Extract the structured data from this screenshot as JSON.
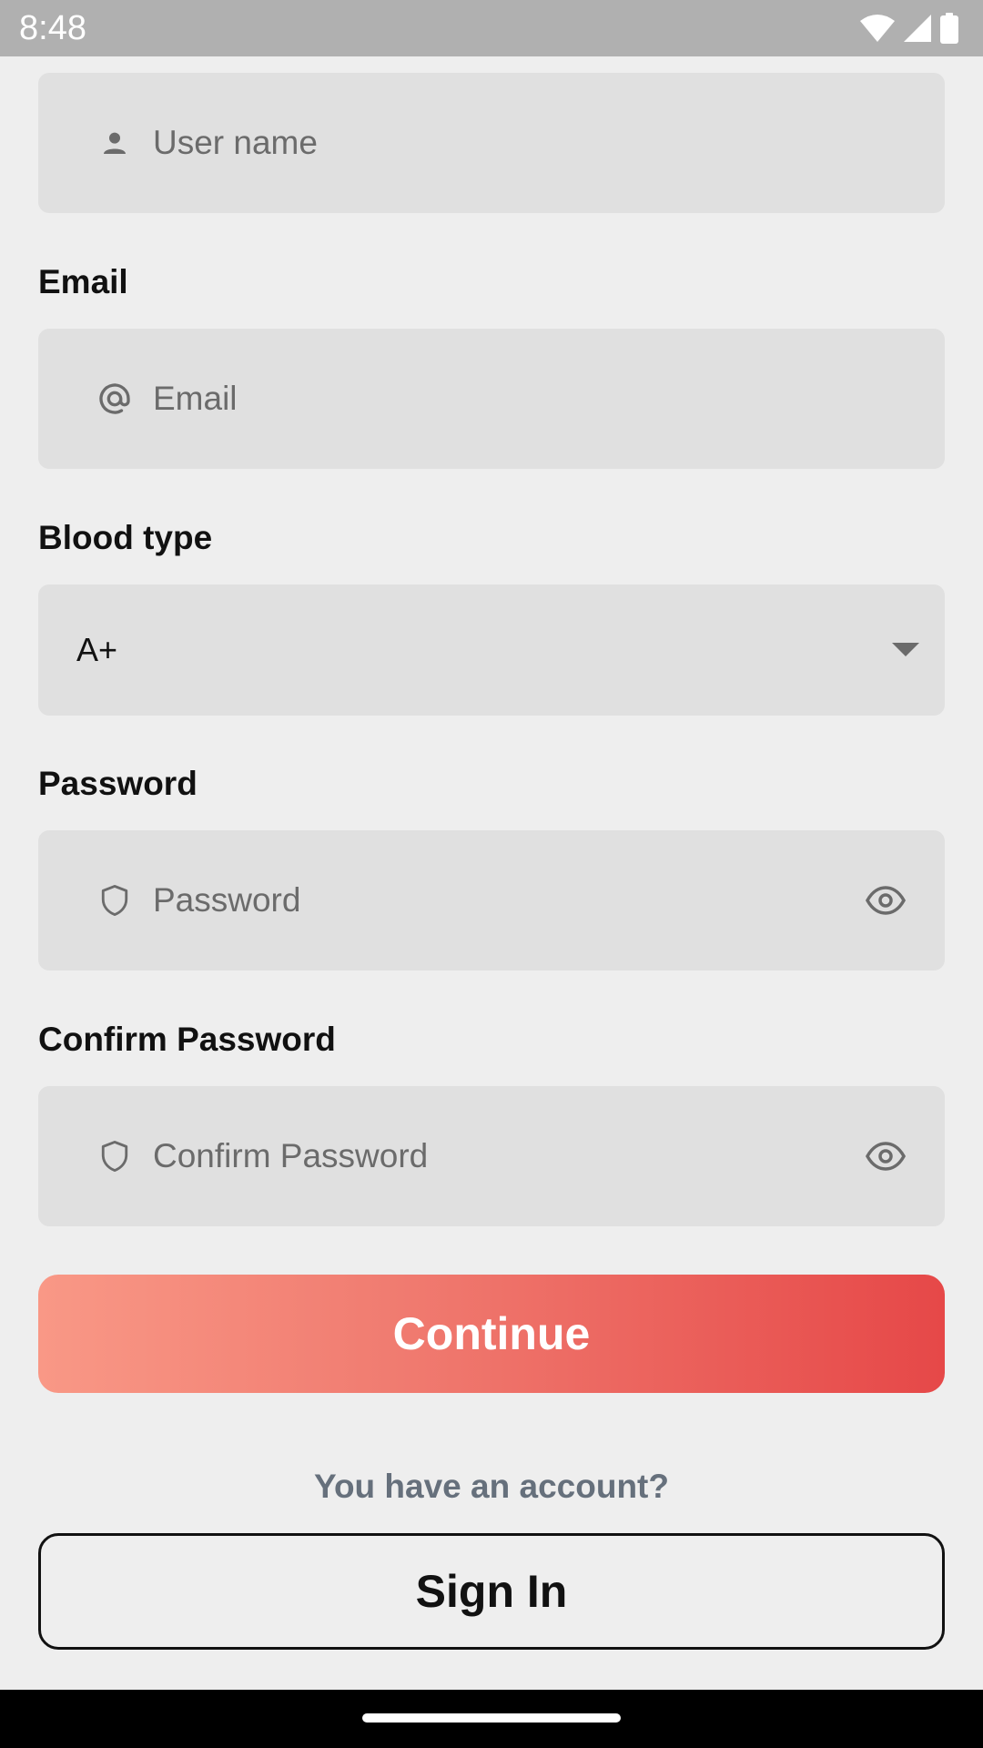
{
  "status_bar": {
    "time": "8:48",
    "icons": [
      "wifi-icon",
      "cell-signal-icon",
      "battery-icon"
    ]
  },
  "form": {
    "username": {
      "placeholder": "User name",
      "icon": "person-icon"
    },
    "email": {
      "label": "Email",
      "placeholder": "Email",
      "icon": "at-sign-icon"
    },
    "blood_type": {
      "label": "Blood type",
      "selected": "A+",
      "icon": "dropdown-arrow-icon"
    },
    "password": {
      "label": "Password",
      "placeholder": "Password",
      "icon": "shield-icon",
      "toggle_icon": "eye-icon"
    },
    "confirm_password": {
      "label": "Confirm Password",
      "placeholder": "Confirm Password",
      "icon": "shield-icon",
      "toggle_icon": "eye-icon"
    }
  },
  "actions": {
    "continue_label": "Continue",
    "account_prompt": "You have an account?",
    "signin_label": "Sign In"
  },
  "colors": {
    "background": "#eeeeee",
    "field_fill": "#e0e0e0",
    "gradient_start": "#f99886",
    "gradient_end": "#e64848",
    "prompt_text": "#66707c",
    "status_bar": "#b0b0b0"
  }
}
